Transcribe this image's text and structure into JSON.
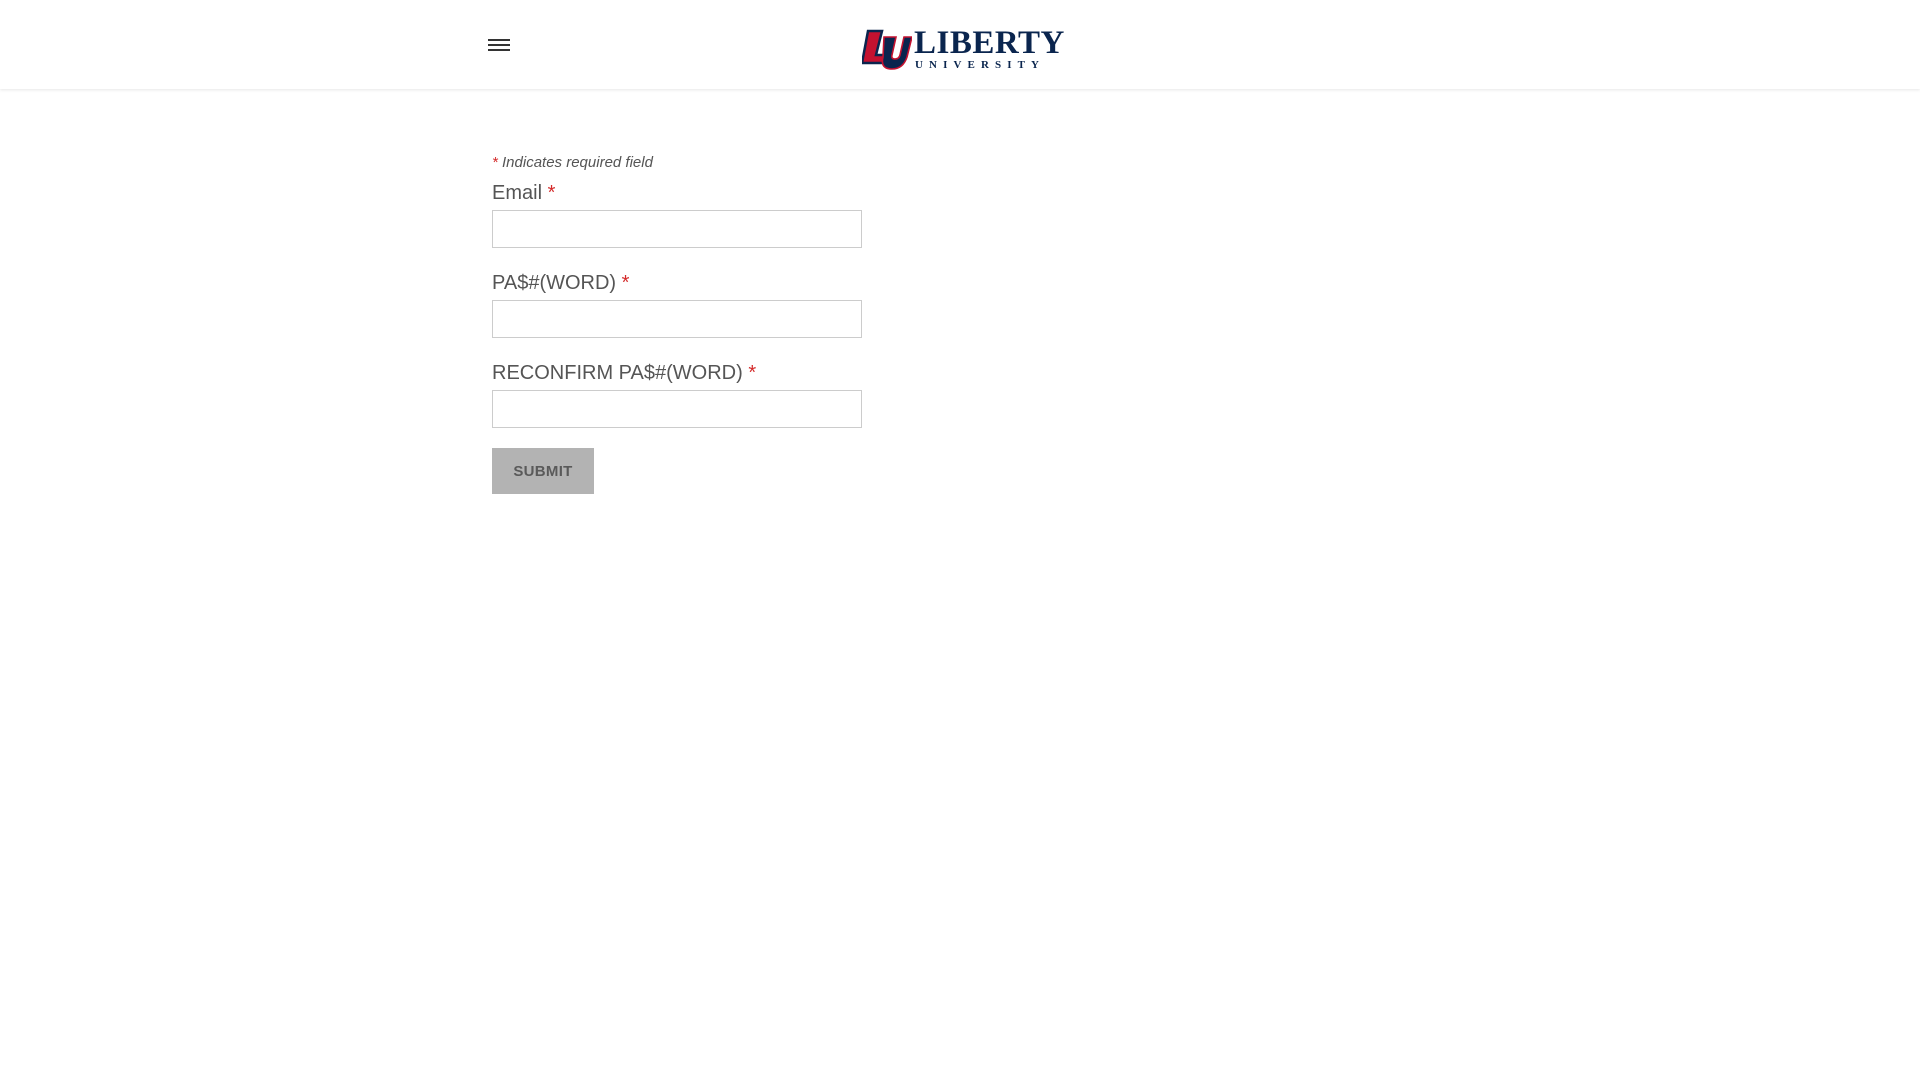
{
  "brand": {
    "logo_mark": "LU",
    "wordmark": "LIBERTY",
    "subline": "UNIVERSITY",
    "colors": {
      "navy": "#0a254e",
      "red": "#c41230"
    }
  },
  "header": {
    "menu_icon": "hamburger-menu-icon"
  },
  "form": {
    "required_note_star": "*",
    "required_note": " Indicates required field",
    "fields": [
      {
        "label": "Email",
        "required_mark": "*",
        "value": ""
      },
      {
        "label": "PA$#(WORD)",
        "required_mark": "*",
        "value": ""
      },
      {
        "label": "RECONFIRM PA$#(WORD)",
        "required_mark": "*",
        "value": ""
      }
    ],
    "submit_label": "SUBMIT"
  }
}
